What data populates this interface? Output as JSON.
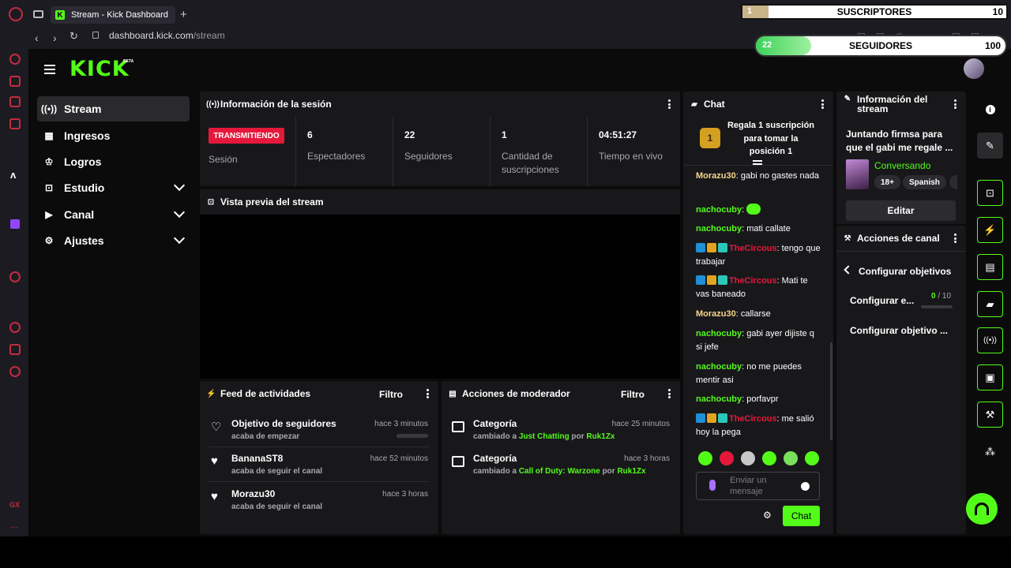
{
  "browser": {
    "tab_title": "Stream - Kick Dashboard",
    "new_tab": "+",
    "url_domain": "dashboard.kick.com",
    "url_path": "/stream",
    "gx_label": "GX",
    "more_label": "…"
  },
  "overlay": {
    "subs_current": "1",
    "subs_label": "SUSCRIPTORES",
    "subs_goal": "10",
    "followers_current": "22",
    "followers_label": "SEGUIDORES",
    "followers_goal": "100",
    "subs_progress": 0.1,
    "followers_progress": 0.22
  },
  "brand": {
    "logo": "KICK",
    "beta": "BETA"
  },
  "nav": {
    "items": [
      {
        "label": "Stream",
        "icon": "broadcast-icon"
      },
      {
        "label": "Ingresos",
        "icon": "chart-icon"
      },
      {
        "label": "Logros",
        "icon": "trophy-icon"
      },
      {
        "label": "Estudio",
        "icon": "studio-icon"
      },
      {
        "label": "Canal",
        "icon": "play-icon"
      },
      {
        "label": "Ajustes",
        "icon": "gear-icon"
      }
    ]
  },
  "session": {
    "title": "Información de la sesión",
    "live_badge": "TRANSMITIENDO",
    "session_label": "Sesión",
    "viewers_value": "6",
    "viewers_label": "Espectadores",
    "followers_value": "22",
    "followers_label": "Seguidores",
    "subs_value": "1",
    "subs_label": "Cantidad de suscripciones",
    "live_time_value": "04:51:27",
    "live_time_label": "Tiempo en vivo"
  },
  "preview": {
    "title": "Vista previa del stream"
  },
  "feed": {
    "title": "Feed de actividades",
    "filter": "Filtro",
    "rows": [
      {
        "title": "Objetivo de seguidores",
        "sub": "acaba de empezar",
        "time": "hace 3 minutos"
      },
      {
        "title": "BananaST8",
        "sub": "acaba de seguir el canal",
        "time": "hace 52 minutos"
      },
      {
        "title": "Morazu30",
        "sub": "acaba de seguir el canal",
        "time": "hace 3 horas"
      }
    ]
  },
  "mod": {
    "title": "Acciones de moderador",
    "filter": "Filtro",
    "rows": [
      {
        "title": "Categoría",
        "prefix": "cambiado a",
        "category": "Just Chatting",
        "by": "por",
        "user": "Ruk1Zx",
        "time": "hace 25 minutos"
      },
      {
        "title": "Categoría",
        "prefix": "cambiado a",
        "category": "Call of Duty: Warzone",
        "by": "por",
        "user": "Ruk1Zx",
        "time": "hace 3 horas"
      }
    ]
  },
  "chat": {
    "title": "Chat",
    "gift_rank": "1",
    "gift_text": "Regala 1 suscripción para tomar la posición 1",
    "messages": [
      {
        "user": "Morazu30",
        "color": "y",
        "text": "gabi no gastes nada"
      },
      {
        "user": "nachocuby",
        "color": "g",
        "text": ""
      },
      {
        "user": "nachocuby",
        "color": "g",
        "text": "mati callate"
      },
      {
        "user": "TheCircous",
        "color": "r",
        "text": "tengo que trabajar"
      },
      {
        "user": "TheCircous",
        "color": "r",
        "text": "Mati te vas baneado"
      },
      {
        "user": "Morazu30",
        "color": "y",
        "text": "callarse"
      },
      {
        "user": "nachocuby",
        "color": "g",
        "text": "gabi ayer dijiste q si jefe"
      },
      {
        "user": "nachocuby",
        "color": "g",
        "text": "no me puedes mentir asi"
      },
      {
        "user": "nachocuby",
        "color": "g",
        "text": "porfavpr"
      },
      {
        "user": "TheCircous",
        "color": "r",
        "text": "me salió hoy la pega"
      }
    ],
    "input_placeholder": "Enviar un mensaje",
    "send_label": "Chat"
  },
  "stream_info": {
    "title": "Información del stream",
    "stream_title": "Juntando firmsa para que el gabi me regale ...",
    "category": "Conversando",
    "tags": [
      "18+",
      "Spanish"
    ],
    "edit_label": "Editar"
  },
  "channel_actions": {
    "title": "Acciones de canal",
    "sub_title": "Configurar objetivos",
    "goal1_label": "Configurar e...",
    "goal1_current": "0",
    "goal1_total": " / 10",
    "goal2_label": "Configurar objetivo ..."
  },
  "colors": {
    "accent": "#53fc18",
    "live": "#e5183b",
    "panel": "#18181b"
  }
}
